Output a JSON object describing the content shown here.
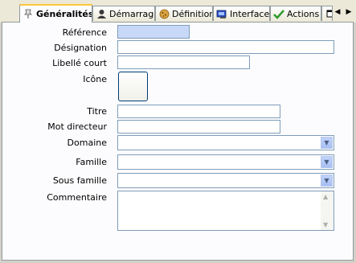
{
  "tabs": [
    {
      "label": "Généralités",
      "icon": "pin-icon",
      "active": true
    },
    {
      "label": "Démarrage",
      "icon": "person-icon",
      "active": false
    },
    {
      "label": "Définition",
      "icon": "cookie-icon",
      "active": false
    },
    {
      "label": "Interface",
      "icon": "window-icon",
      "active": false
    },
    {
      "label": "Actions",
      "icon": "checkmark-icon",
      "active": false
    }
  ],
  "labels": {
    "reference": "Référence",
    "designation": "Désignation",
    "libelle_court": "Libellé court",
    "icone": "Icône",
    "titre": "Titre",
    "mot_directeur": "Mot directeur",
    "domaine": "Domaine",
    "famille": "Famille",
    "sous_famille": "Sous famille",
    "commentaire": "Commentaire"
  },
  "values": {
    "reference": "",
    "designation": "",
    "libelle_court": "",
    "titre": "",
    "mot_directeur": "",
    "domaine": "",
    "famille": "",
    "sous_famille": "",
    "commentaire": ""
  },
  "colors": {
    "accent_tab_border": "#ffc83c",
    "reference_field_bg": "#c8d8f8",
    "field_border": "#7f9db9"
  }
}
